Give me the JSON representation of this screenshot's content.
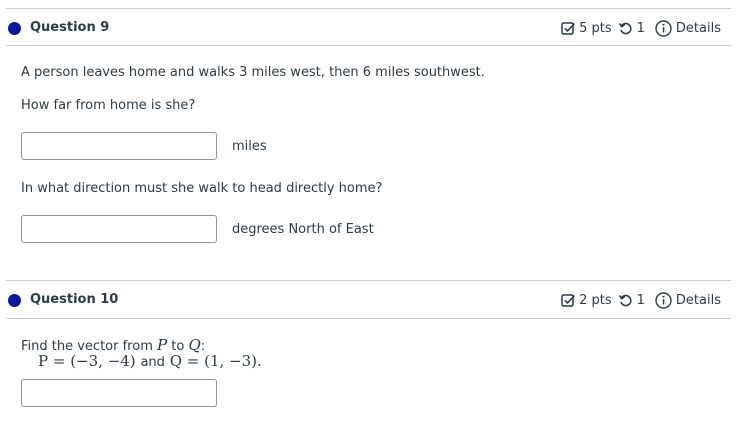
{
  "questions": [
    {
      "title": "Question 9",
      "points": "5 pts",
      "attempts": "1",
      "details_label": "Details",
      "prompt": "A person leaves home and walks 3 miles west, then 6 miles southwest.",
      "sub1": "How far from home is she?",
      "unit1": "miles",
      "sub2": "In what direction must she walk to head directly home?",
      "unit2": "degrees North of East",
      "answer1_value": "",
      "answer2_value": ""
    },
    {
      "title": "Question 10",
      "points": "2 pts",
      "attempts": "1",
      "details_label": "Details",
      "prompt_prefix": "Find the vector from",
      "prompt_p": "P",
      "prompt_to": "to",
      "prompt_q": "Q",
      "prompt_colon": ":",
      "math_p_expr": "P = (−3, −4)",
      "math_and": "and",
      "math_q_expr": "Q = (1, −3).",
      "answer_value": ""
    }
  ],
  "colors": {
    "accent_dot": "#0b1a9c",
    "text": "#2d3b45",
    "divider": "#c7cdd1"
  },
  "icons": {
    "points": "checkbox-edit-icon",
    "attempts": "retry-icon",
    "details": "info-circle-icon"
  }
}
